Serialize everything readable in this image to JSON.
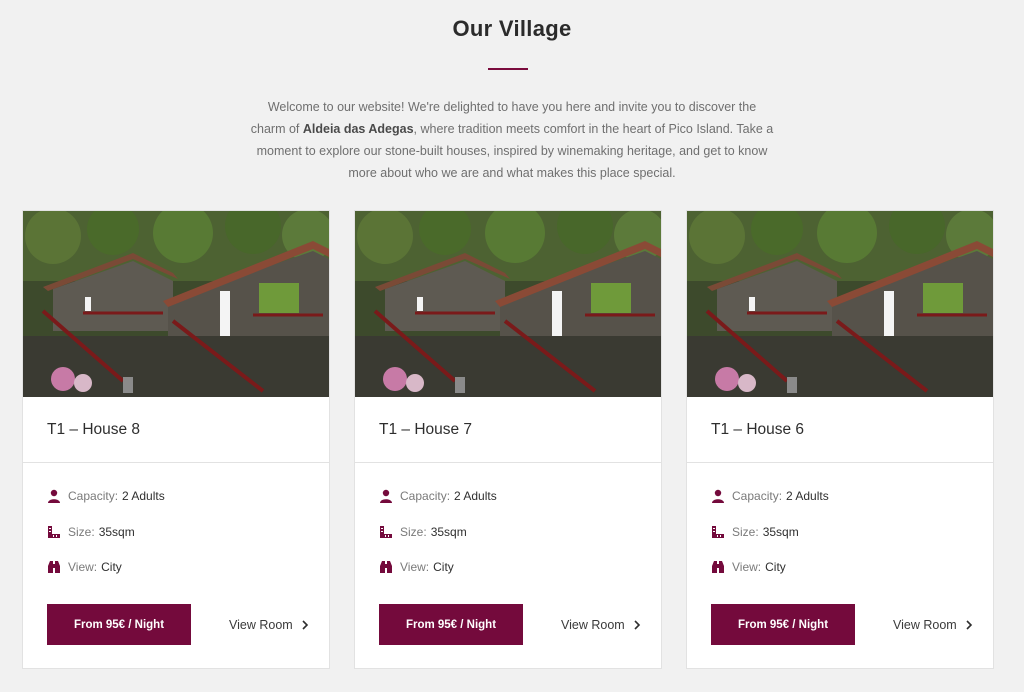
{
  "section": {
    "title": "Our Village",
    "intro_before": "Welcome to our website! We're delighted to have you here and invite you to discover the charm of ",
    "intro_bold": "Aldeia das Adegas",
    "intro_after": ", where tradition meets comfort in the heart of Pico Island. Take a moment to explore our stone-built houses, inspired by winemaking heritage, and get to know more about who we are and what makes this place special."
  },
  "colors": {
    "accent": "#740a3c",
    "background": "#f1f1f1",
    "card": "#ffffff"
  },
  "cards": [
    {
      "title": "T1 – House 8",
      "capacity_label": "Capacity:",
      "capacity_value": "2 Adults",
      "size_label": "Size:",
      "size_value": "35sqm",
      "view_label": "View:",
      "view_value": "City",
      "price_button": "From 95€ / Night",
      "view_room": "View Room",
      "image_icon": "stone-house-photo"
    },
    {
      "title": "T1 – House 7",
      "capacity_label": "Capacity:",
      "capacity_value": "2 Adults",
      "size_label": "Size:",
      "size_value": "35sqm",
      "view_label": "View:",
      "view_value": "City",
      "price_button": "From 95€ / Night",
      "view_room": "View Room",
      "image_icon": "stone-house-photo"
    },
    {
      "title": "T1 – House 6",
      "capacity_label": "Capacity:",
      "capacity_value": "2 Adults",
      "size_label": "Size:",
      "size_value": "35sqm",
      "view_label": "View:",
      "view_value": "City",
      "price_button": "From 95€ / Night",
      "view_room": "View Room",
      "image_icon": "stone-house-photo"
    }
  ],
  "icons": {
    "capacity": "user-icon",
    "size": "ruler-icon",
    "view": "binoculars-icon",
    "view_room": "chevron-right-icon"
  }
}
